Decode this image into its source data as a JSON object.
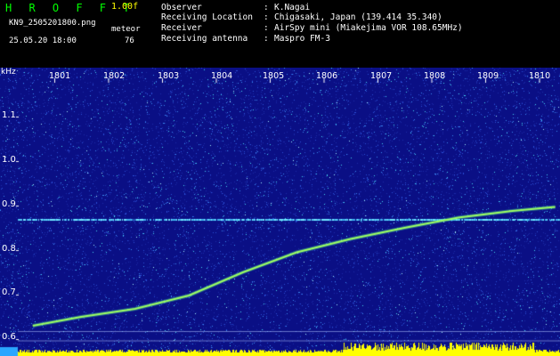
{
  "header": {
    "app_title": "H R O F F T",
    "version": "1.00f",
    "file_name": "KN9_2505201800.png",
    "datetime": "25.05.20 18:00",
    "meteor_label": "meteor",
    "meteor_count": "76"
  },
  "station_info": [
    {
      "key": "Observer",
      "sep": ":",
      "value": "K.Nagai"
    },
    {
      "key": "Receiving Location",
      "sep": ":",
      "value": "Chigasaki, Japan (139.414 35.340)"
    },
    {
      "key": "Receiver",
      "sep": ":",
      "value": "AirSpy mini (Miakejima VOR 108.65MHz)"
    },
    {
      "key": "Receiving antenna",
      "sep": ":",
      "value": "Maspro FM-3"
    }
  ],
  "spectrogram": {
    "y_unit": "kHz",
    "y_ticks": [
      "1.1",
      "1.0",
      "0.9",
      "0.8",
      "0.7",
      "0.6"
    ],
    "x_ticks": [
      "1801",
      "1802",
      "1803",
      "1804",
      "1805",
      "1806",
      "1807",
      "1808",
      "1809",
      "1810"
    ],
    "y_range_khz": [
      0.58,
      1.23
    ],
    "x_range_min": [
      1800.6,
      1810.3
    ],
    "background_color": "#0a0f85",
    "noise_colors": [
      "#1a2aa8",
      "#2b50d8",
      "#3b8cf0",
      "#46d6f0",
      "#a8f4ff"
    ],
    "steady_carrier_khz": 0.87,
    "trace_color": "#c8ff40",
    "trace_points": [
      [
        1800.6,
        0.63
      ],
      [
        1801.5,
        0.65
      ],
      [
        1802.5,
        0.668
      ],
      [
        1803.5,
        0.698
      ],
      [
        1804.5,
        0.75
      ],
      [
        1805.5,
        0.795
      ],
      [
        1806.5,
        0.825
      ],
      [
        1807.5,
        0.85
      ],
      [
        1808.5,
        0.873
      ],
      [
        1809.5,
        0.888
      ],
      [
        1810.3,
        0.897
      ]
    ],
    "bottom_signal_color": "#ffff00"
  }
}
